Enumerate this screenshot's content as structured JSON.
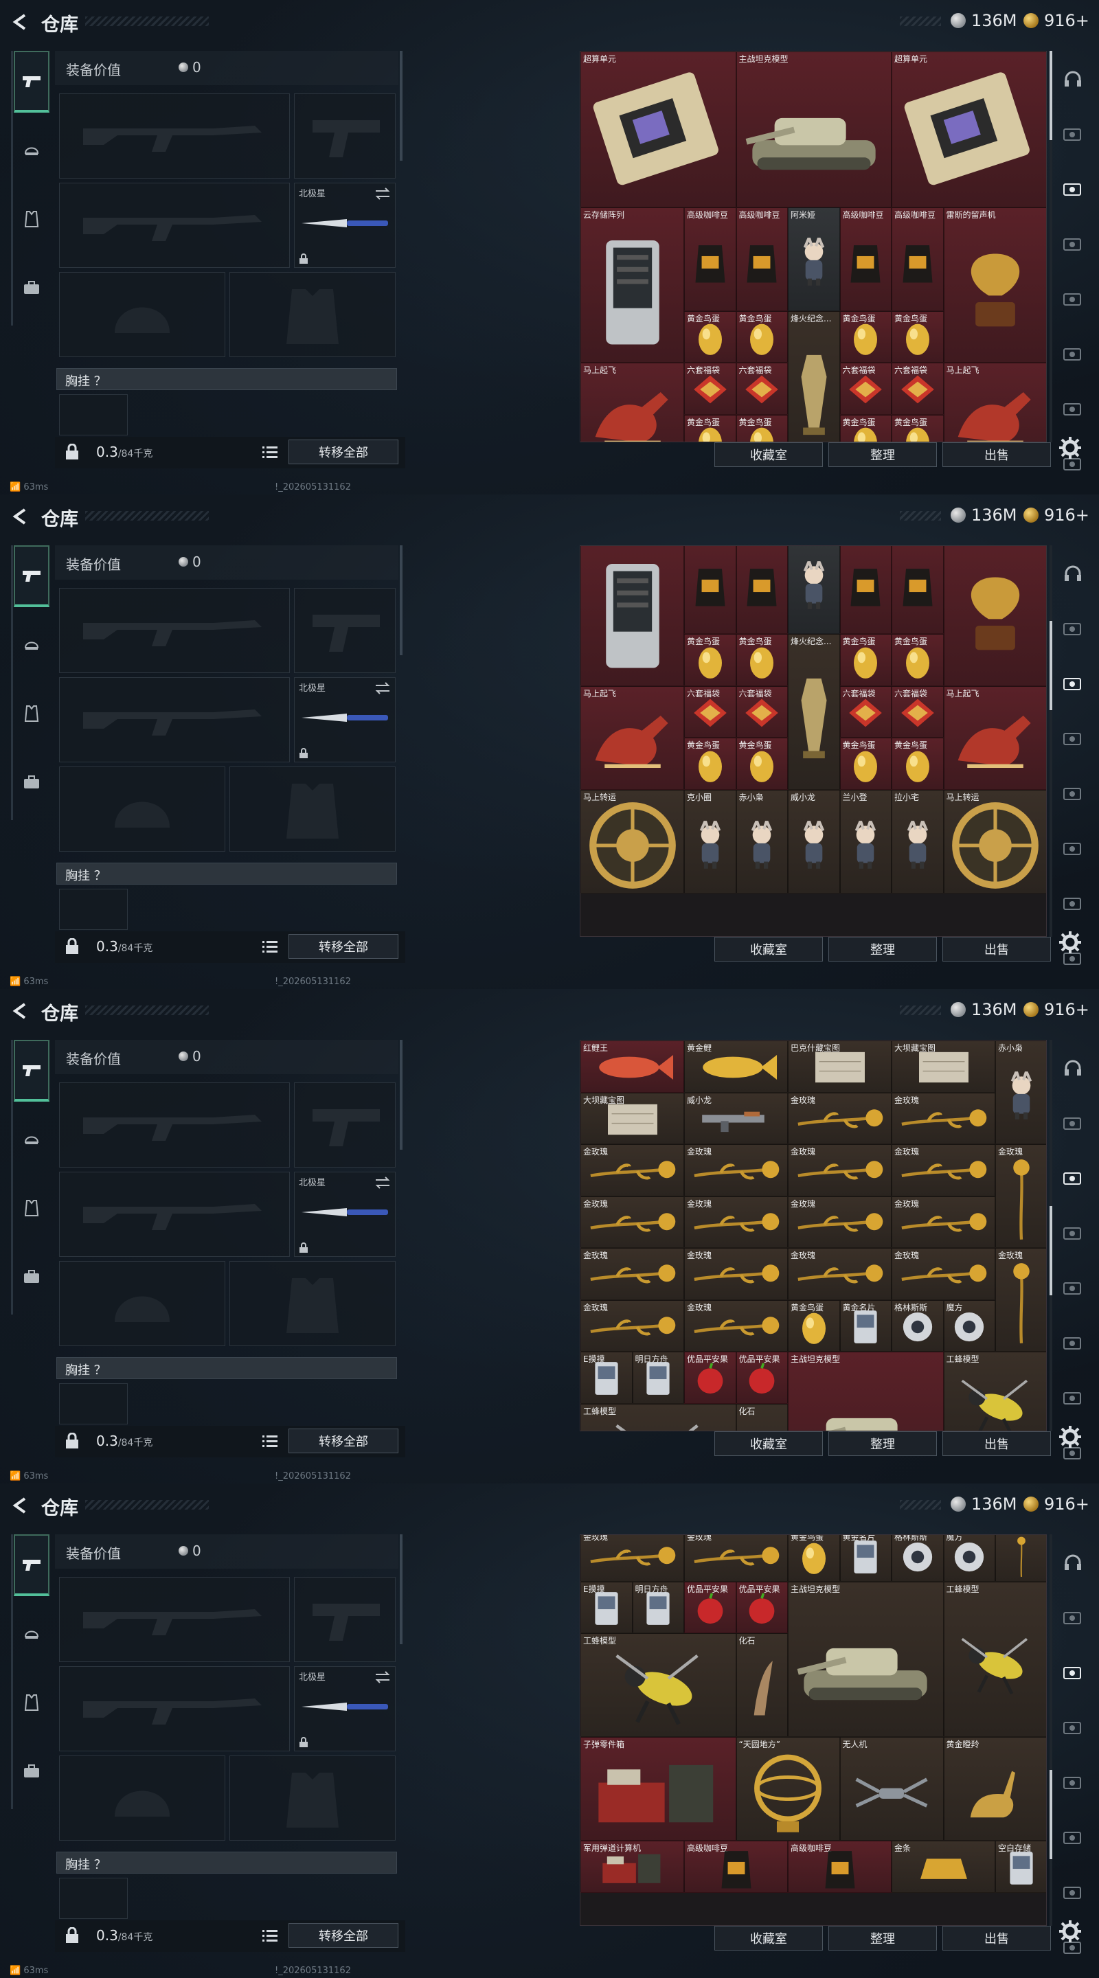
{
  "header": {
    "title": "仓库",
    "currency_silver": "136M",
    "currency_gold": "916+"
  },
  "equipment": {
    "value_label": "装备价值",
    "value": "0",
    "slot_melee_name": "北极星",
    "chest_label": "胸挂 ？",
    "weight": "0.3",
    "weight_cap": "/84千克",
    "transfer_all": "转移全部"
  },
  "status": {
    "ping": "63ms",
    "build": "!_202605131162"
  },
  "buttons": {
    "collection": "收藏室",
    "sort": "整理",
    "sell": "出售"
  },
  "frames": [
    {
      "scroll": 0.0,
      "cells": [
        {
          "n": "超算单元",
          "c": "c-red",
          "x": 0,
          "y": 0,
          "w": 3,
          "h": 3,
          "a": "gpu"
        },
        {
          "n": "主战坦克模型",
          "c": "c-red",
          "x": 3,
          "y": 0,
          "w": 3,
          "h": 3,
          "a": "tank"
        },
        {
          "n": "超算单元",
          "c": "c-red",
          "x": 6,
          "y": 0,
          "w": 3,
          "h": 3,
          "a": "gpu"
        },
        {
          "n": "云存储阵列",
          "c": "c-red",
          "x": 0,
          "y": 3,
          "w": 2,
          "h": 3,
          "a": "server"
        },
        {
          "n": "高级咖啡豆",
          "c": "c-red",
          "x": 2,
          "y": 3,
          "w": 1,
          "h": 2,
          "a": "coffee"
        },
        {
          "n": "高级咖啡豆",
          "c": "c-red",
          "x": 3,
          "y": 3,
          "w": 1,
          "h": 2,
          "a": "coffee"
        },
        {
          "n": "阿米娅",
          "c": "c-gry",
          "x": 4,
          "y": 3,
          "w": 1,
          "h": 2,
          "a": "figure"
        },
        {
          "n": "高级咖啡豆",
          "c": "c-red",
          "x": 5,
          "y": 3,
          "w": 1,
          "h": 2,
          "a": "coffee"
        },
        {
          "n": "高级咖啡豆",
          "c": "c-red",
          "x": 6,
          "y": 3,
          "w": 1,
          "h": 2,
          "a": "coffee"
        },
        {
          "n": "雷斯的留声机",
          "c": "c-red",
          "x": 7,
          "y": 3,
          "w": 2,
          "h": 3,
          "a": "phono"
        },
        {
          "n": "黄金鸟蛋",
          "c": "c-red",
          "x": 2,
          "y": 5,
          "w": 1,
          "h": 1,
          "a": "egg"
        },
        {
          "n": "黄金鸟蛋",
          "c": "c-red",
          "x": 3,
          "y": 5,
          "w": 1,
          "h": 1,
          "a": "egg"
        },
        {
          "n": "烽火纪念...",
          "c": "c-brn",
          "x": 4,
          "y": 5,
          "w": 1,
          "h": 3,
          "a": "trophy"
        },
        {
          "n": "黄金鸟蛋",
          "c": "c-red",
          "x": 5,
          "y": 5,
          "w": 1,
          "h": 1,
          "a": "egg"
        },
        {
          "n": "黄金鸟蛋",
          "c": "c-red",
          "x": 6,
          "y": 5,
          "w": 1,
          "h": 1,
          "a": "egg"
        },
        {
          "n": "马上起飞",
          "c": "c-red",
          "x": 0,
          "y": 6,
          "w": 2,
          "h": 2,
          "a": "horse"
        },
        {
          "n": "六套福袋",
          "c": "c-red",
          "x": 2,
          "y": 6,
          "w": 1,
          "h": 1,
          "a": "bag"
        },
        {
          "n": "六套福袋",
          "c": "c-red",
          "x": 3,
          "y": 6,
          "w": 1,
          "h": 1,
          "a": "bag"
        },
        {
          "n": "六套福袋",
          "c": "c-red",
          "x": 5,
          "y": 6,
          "w": 1,
          "h": 1,
          "a": "bag"
        },
        {
          "n": "六套福袋",
          "c": "c-red",
          "x": 6,
          "y": 6,
          "w": 1,
          "h": 1,
          "a": "bag"
        },
        {
          "n": "马上起飞",
          "c": "c-red",
          "x": 7,
          "y": 6,
          "w": 2,
          "h": 2,
          "a": "horse"
        },
        {
          "n": "黄金鸟蛋",
          "c": "c-red",
          "x": 2,
          "y": 7,
          "w": 1,
          "h": 1,
          "a": "egg"
        },
        {
          "n": "黄金鸟蛋",
          "c": "c-red",
          "x": 3,
          "y": 7,
          "w": 1,
          "h": 1,
          "a": "egg"
        },
        {
          "n": "黄金鸟蛋",
          "c": "c-red",
          "x": 5,
          "y": 7,
          "w": 1,
          "h": 1,
          "a": "egg"
        },
        {
          "n": "黄金鸟蛋",
          "c": "c-red",
          "x": 6,
          "y": 7,
          "w": 1,
          "h": 1,
          "a": "egg"
        }
      ]
    },
    {
      "scroll": 0.25,
      "cells": [
        {
          "n": "云存储阵列",
          "c": "c-red",
          "x": 0,
          "y": -0.3,
          "w": 2,
          "h": 3,
          "a": "server"
        },
        {
          "n": "高级咖啡豆",
          "c": "c-red",
          "x": 2,
          "y": -0.3,
          "w": 1,
          "h": 2,
          "a": "coffee"
        },
        {
          "n": "高级咖啡豆",
          "c": "c-red",
          "x": 3,
          "y": -0.3,
          "w": 1,
          "h": 2,
          "a": "coffee"
        },
        {
          "n": "阿米娅",
          "c": "c-gry",
          "x": 4,
          "y": -0.3,
          "w": 1,
          "h": 2,
          "a": "figure"
        },
        {
          "n": "高级咖啡豆",
          "c": "c-red",
          "x": 5,
          "y": -0.3,
          "w": 1,
          "h": 2,
          "a": "coffee"
        },
        {
          "n": "高级咖啡豆",
          "c": "c-red",
          "x": 6,
          "y": -0.3,
          "w": 1,
          "h": 2,
          "a": "coffee"
        },
        {
          "n": "雷斯的留声机",
          "c": "c-red",
          "x": 7,
          "y": -0.3,
          "w": 2,
          "h": 3,
          "a": "phono"
        },
        {
          "n": "黄金鸟蛋",
          "c": "c-red",
          "x": 2,
          "y": 1.7,
          "w": 1,
          "h": 1,
          "a": "egg"
        },
        {
          "n": "黄金鸟蛋",
          "c": "c-red",
          "x": 3,
          "y": 1.7,
          "w": 1,
          "h": 1,
          "a": "egg"
        },
        {
          "n": "烽火纪念...",
          "c": "c-brn",
          "x": 4,
          "y": 1.7,
          "w": 1,
          "h": 3,
          "a": "trophy"
        },
        {
          "n": "黄金鸟蛋",
          "c": "c-red",
          "x": 5,
          "y": 1.7,
          "w": 1,
          "h": 1,
          "a": "egg"
        },
        {
          "n": "黄金鸟蛋",
          "c": "c-red",
          "x": 6,
          "y": 1.7,
          "w": 1,
          "h": 1,
          "a": "egg"
        },
        {
          "n": "马上起飞",
          "c": "c-red",
          "x": 0,
          "y": 2.7,
          "w": 2,
          "h": 2,
          "a": "horse"
        },
        {
          "n": "六套福袋",
          "c": "c-red",
          "x": 2,
          "y": 2.7,
          "w": 1,
          "h": 1,
          "a": "bag"
        },
        {
          "n": "六套福袋",
          "c": "c-red",
          "x": 3,
          "y": 2.7,
          "w": 1,
          "h": 1,
          "a": "bag"
        },
        {
          "n": "六套福袋",
          "c": "c-red",
          "x": 5,
          "y": 2.7,
          "w": 1,
          "h": 1,
          "a": "bag"
        },
        {
          "n": "六套福袋",
          "c": "c-red",
          "x": 6,
          "y": 2.7,
          "w": 1,
          "h": 1,
          "a": "bag"
        },
        {
          "n": "马上起飞",
          "c": "c-red",
          "x": 7,
          "y": 2.7,
          "w": 2,
          "h": 2,
          "a": "horse"
        },
        {
          "n": "黄金鸟蛋",
          "c": "c-red",
          "x": 2,
          "y": 3.7,
          "w": 1,
          "h": 1,
          "a": "egg"
        },
        {
          "n": "黄金鸟蛋",
          "c": "c-red",
          "x": 3,
          "y": 3.7,
          "w": 1,
          "h": 1,
          "a": "egg"
        },
        {
          "n": "黄金鸟蛋",
          "c": "c-red",
          "x": 5,
          "y": 3.7,
          "w": 1,
          "h": 1,
          "a": "egg"
        },
        {
          "n": "黄金鸟蛋",
          "c": "c-red",
          "x": 6,
          "y": 3.7,
          "w": 1,
          "h": 1,
          "a": "egg"
        },
        {
          "n": "马上转运",
          "c": "c-brn",
          "x": 0,
          "y": 4.7,
          "w": 2,
          "h": 2,
          "a": "wheel"
        },
        {
          "n": "克小圈",
          "c": "c-brn",
          "x": 2,
          "y": 4.7,
          "w": 1,
          "h": 2,
          "a": "figure"
        },
        {
          "n": "赤小枭",
          "c": "c-brn",
          "x": 3,
          "y": 4.7,
          "w": 1,
          "h": 2,
          "a": "figure"
        },
        {
          "n": "威小龙",
          "c": "c-brn",
          "x": 4,
          "y": 4.7,
          "w": 1,
          "h": 2,
          "a": "figure"
        },
        {
          "n": "兰小登",
          "c": "c-brn",
          "x": 5,
          "y": 4.7,
          "w": 1,
          "h": 2,
          "a": "figure"
        },
        {
          "n": "拉小宅",
          "c": "c-brn",
          "x": 6,
          "y": 4.7,
          "w": 1,
          "h": 2,
          "a": "figure"
        },
        {
          "n": "马上转运",
          "c": "c-brn",
          "x": 7,
          "y": 4.7,
          "w": 2,
          "h": 2,
          "a": "wheel"
        }
      ]
    },
    {
      "scroll": 0.55,
      "cells": [
        {
          "n": "红鲤王",
          "c": "c-red",
          "x": 0,
          "y": 0,
          "w": 2,
          "h": 1,
          "a": "fishR"
        },
        {
          "n": "黄金鲤",
          "c": "c-brn",
          "x": 2,
          "y": 0,
          "w": 2,
          "h": 1,
          "a": "fishY"
        },
        {
          "n": "巴克什藏宝图",
          "c": "c-brn",
          "x": 4,
          "y": 0,
          "w": 2,
          "h": 1,
          "a": "map"
        },
        {
          "n": "大坝藏宝图",
          "c": "c-brn",
          "x": 6,
          "y": 0,
          "w": 2,
          "h": 1,
          "a": "map"
        },
        {
          "n": "赤小枭",
          "c": "c-brn",
          "x": 8,
          "y": 0,
          "w": 1,
          "h": 2,
          "a": "figure"
        },
        {
          "n": "大坝藏宝图",
          "c": "c-brn",
          "x": 0,
          "y": 1,
          "w": 2,
          "h": 1,
          "a": "map"
        },
        {
          "n": "威小龙",
          "c": "c-brn",
          "x": 2,
          "y": 1,
          "w": 2,
          "h": 1,
          "a": "gun"
        },
        {
          "n": "金玫瑰",
          "c": "c-brn",
          "x": 4,
          "y": 1,
          "w": 2,
          "h": 1,
          "a": "rose"
        },
        {
          "n": "金玫瑰",
          "c": "c-brn",
          "x": 6,
          "y": 1,
          "w": 2,
          "h": 1,
          "a": "rose"
        },
        {
          "n": "金玫瑰",
          "c": "c-brn",
          "x": 0,
          "y": 2,
          "w": 2,
          "h": 1,
          "a": "rose"
        },
        {
          "n": "金玫瑰",
          "c": "c-brn",
          "x": 2,
          "y": 2,
          "w": 2,
          "h": 1,
          "a": "rose"
        },
        {
          "n": "金玫瑰",
          "c": "c-brn",
          "x": 4,
          "y": 2,
          "w": 2,
          "h": 1,
          "a": "rose"
        },
        {
          "n": "金玫瑰",
          "c": "c-brn",
          "x": 6,
          "y": 2,
          "w": 2,
          "h": 1,
          "a": "rose"
        },
        {
          "n": "金玫瑰",
          "c": "c-brn",
          "x": 8,
          "y": 2,
          "w": 1,
          "h": 2,
          "a": "roseV"
        },
        {
          "n": "金玫瑰",
          "c": "c-brn",
          "x": 0,
          "y": 3,
          "w": 2,
          "h": 1,
          "a": "rose"
        },
        {
          "n": "金玫瑰",
          "c": "c-brn",
          "x": 2,
          "y": 3,
          "w": 2,
          "h": 1,
          "a": "rose"
        },
        {
          "n": "金玫瑰",
          "c": "c-brn",
          "x": 4,
          "y": 3,
          "w": 2,
          "h": 1,
          "a": "rose"
        },
        {
          "n": "金玫瑰",
          "c": "c-brn",
          "x": 6,
          "y": 3,
          "w": 2,
          "h": 1,
          "a": "rose"
        },
        {
          "n": "金玫瑰",
          "c": "c-brn",
          "x": 0,
          "y": 4,
          "w": 2,
          "h": 1,
          "a": "rose"
        },
        {
          "n": "金玫瑰",
          "c": "c-brn",
          "x": 2,
          "y": 4,
          "w": 2,
          "h": 1,
          "a": "rose"
        },
        {
          "n": "金玫瑰",
          "c": "c-brn",
          "x": 4,
          "y": 4,
          "w": 2,
          "h": 1,
          "a": "rose"
        },
        {
          "n": "金玫瑰",
          "c": "c-brn",
          "x": 6,
          "y": 4,
          "w": 2,
          "h": 1,
          "a": "rose"
        },
        {
          "n": "金玫瑰",
          "c": "c-brn",
          "x": 8,
          "y": 4,
          "w": 1,
          "h": 2,
          "a": "roseV"
        },
        {
          "n": "金玫瑰",
          "c": "c-brn",
          "x": 0,
          "y": 5,
          "w": 2,
          "h": 1,
          "a": "rose"
        },
        {
          "n": "金玫瑰",
          "c": "c-brn",
          "x": 2,
          "y": 5,
          "w": 2,
          "h": 1,
          "a": "rose"
        },
        {
          "n": "黄金鸟蛋",
          "c": "c-brn",
          "x": 4,
          "y": 5,
          "w": 1,
          "h": 1,
          "a": "egg"
        },
        {
          "n": "黄金名片",
          "c": "c-brn",
          "x": 5,
          "y": 5,
          "w": 1,
          "h": 1,
          "a": "card"
        },
        {
          "n": "格林斯斯",
          "c": "c-brn",
          "x": 6,
          "y": 5,
          "w": 1,
          "h": 1,
          "a": "orb"
        },
        {
          "n": "魔方",
          "c": "c-brn",
          "x": 7,
          "y": 5,
          "w": 1,
          "h": 1,
          "a": "orb"
        },
        {
          "n": "E摸摸",
          "c": "c-brn",
          "x": 0,
          "y": 6,
          "w": 1,
          "h": 1,
          "a": "card"
        },
        {
          "n": "明日方舟",
          "c": "c-brn",
          "x": 1,
          "y": 6,
          "w": 1,
          "h": 1,
          "a": "card"
        },
        {
          "n": "优品平安果",
          "c": "c-red",
          "x": 2,
          "y": 6,
          "w": 1,
          "h": 1,
          "a": "apple"
        },
        {
          "n": "优品平安果",
          "c": "c-red",
          "x": 3,
          "y": 6,
          "w": 1,
          "h": 1,
          "a": "apple"
        },
        {
          "n": "主战坦克模型",
          "c": "c-red",
          "x": 4,
          "y": 6,
          "w": 3,
          "h": 3,
          "a": "tank"
        },
        {
          "n": "工蜂模型",
          "c": "c-brn",
          "x": 7,
          "y": 6,
          "w": 2,
          "h": 2,
          "a": "bee"
        },
        {
          "n": "工蜂模型",
          "c": "c-brn",
          "x": 0,
          "y": 7,
          "w": 3,
          "h": 2,
          "a": "bee"
        },
        {
          "n": "化石",
          "c": "c-brn",
          "x": 3,
          "y": 7,
          "w": 1,
          "h": 2,
          "a": "fossil"
        }
      ]
    },
    {
      "scroll": 0.78,
      "cells": [
        {
          "n": "金玫瑰",
          "c": "c-brn",
          "x": 0,
          "y": -0.1,
          "w": 2,
          "h": 1,
          "a": "rose"
        },
        {
          "n": "金玫瑰",
          "c": "c-brn",
          "x": 2,
          "y": -0.1,
          "w": 2,
          "h": 1,
          "a": "rose"
        },
        {
          "n": "黄金鸟蛋",
          "c": "c-brn",
          "x": 4,
          "y": -0.1,
          "w": 1,
          "h": 1,
          "a": "egg"
        },
        {
          "n": "黄金名片",
          "c": "c-brn",
          "x": 5,
          "y": -0.1,
          "w": 1,
          "h": 1,
          "a": "card"
        },
        {
          "n": "格林斯斯",
          "c": "c-brn",
          "x": 6,
          "y": -0.1,
          "w": 1,
          "h": 1,
          "a": "orb"
        },
        {
          "n": "魔方",
          "c": "c-brn",
          "x": 7,
          "y": -0.1,
          "w": 1,
          "h": 1,
          "a": "orb"
        },
        {
          "n": "",
          "c": "c-brn",
          "x": 8,
          "y": -0.1,
          "w": 1,
          "h": 1,
          "a": "roseV"
        },
        {
          "n": "E摸摸",
          "c": "c-brn",
          "x": 0,
          "y": 0.9,
          "w": 1,
          "h": 1,
          "a": "card"
        },
        {
          "n": "明日方舟",
          "c": "c-brn",
          "x": 1,
          "y": 0.9,
          "w": 1,
          "h": 1,
          "a": "card"
        },
        {
          "n": "优品平安果",
          "c": "c-red",
          "x": 2,
          "y": 0.9,
          "w": 1,
          "h": 1,
          "a": "apple"
        },
        {
          "n": "优品平安果",
          "c": "c-red",
          "x": 3,
          "y": 0.9,
          "w": 1,
          "h": 1,
          "a": "apple"
        },
        {
          "n": "主战坦克模型",
          "c": "c-brn",
          "x": 4,
          "y": 0.9,
          "w": 3,
          "h": 3,
          "a": "tank"
        },
        {
          "n": "工蜂模型",
          "c": "c-brn",
          "x": 7,
          "y": 0.9,
          "w": 2,
          "h": 3,
          "a": "bee"
        },
        {
          "n": "工蜂模型",
          "c": "c-brn",
          "x": 0,
          "y": 1.9,
          "w": 3,
          "h": 2,
          "a": "bee"
        },
        {
          "n": "化石",
          "c": "c-brn",
          "x": 3,
          "y": 1.9,
          "w": 1,
          "h": 2,
          "a": "fossil"
        },
        {
          "n": "子弹零件箱",
          "c": "c-red",
          "x": 0,
          "y": 3.9,
          "w": 3,
          "h": 2,
          "a": "crate"
        },
        {
          "n": "“天圆地方”",
          "c": "c-brn",
          "x": 3,
          "y": 3.9,
          "w": 2,
          "h": 2,
          "a": "globe"
        },
        {
          "n": "无人机",
          "c": "c-brn",
          "x": 5,
          "y": 3.9,
          "w": 2,
          "h": 2,
          "a": "drone"
        },
        {
          "n": "黄金瞪羚",
          "c": "c-brn",
          "x": 7,
          "y": 3.9,
          "w": 2,
          "h": 2,
          "a": "gazelle"
        },
        {
          "n": "军用弹道计算机",
          "c": "c-red",
          "x": 0,
          "y": 5.9,
          "w": 2,
          "h": 1,
          "a": "crate"
        },
        {
          "n": "高级咖啡豆",
          "c": "c-red",
          "x": 2,
          "y": 5.9,
          "w": 2,
          "h": 1,
          "a": "coffee"
        },
        {
          "n": "高级咖啡豆",
          "c": "c-red",
          "x": 4,
          "y": 5.9,
          "w": 2,
          "h": 1,
          "a": "coffee"
        },
        {
          "n": "金条",
          "c": "c-brn",
          "x": 6,
          "y": 5.9,
          "w": 2,
          "h": 1,
          "a": "goldbar"
        },
        {
          "n": "空白存储",
          "c": "c-brn",
          "x": 8,
          "y": 5.9,
          "w": 1,
          "h": 1,
          "a": "card"
        }
      ]
    }
  ]
}
